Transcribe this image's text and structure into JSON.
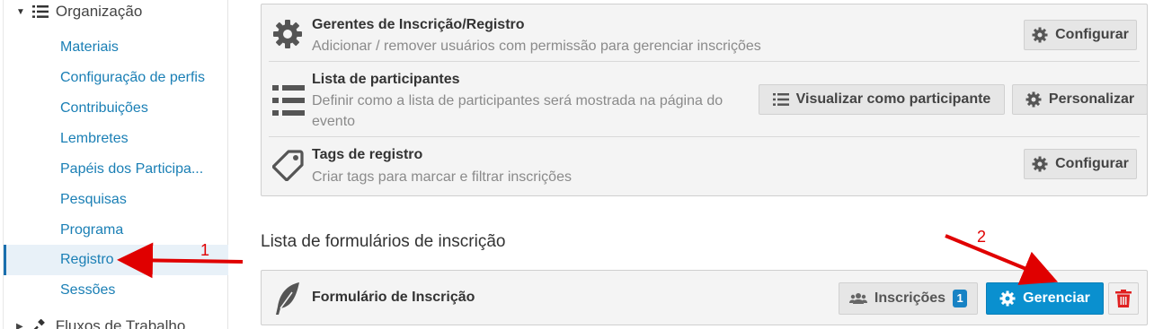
{
  "sidebar": {
    "section_label": "Organização",
    "items": [
      {
        "label": "Materiais"
      },
      {
        "label": "Configuração de perfis"
      },
      {
        "label": "Contribuições"
      },
      {
        "label": "Lembretes"
      },
      {
        "label": "Papéis dos Participa..."
      },
      {
        "label": "Pesquisas"
      },
      {
        "label": "Programa"
      },
      {
        "label": "Registro"
      },
      {
        "label": "Sessões"
      }
    ],
    "active_item": "Registro",
    "next_section_label": "Fluxos de Trabalho"
  },
  "settings": {
    "rows": [
      {
        "title": "Gerentes de Inscrição/Registro",
        "description": "Adicionar / remover usuários com permissão para gerenciar inscrições",
        "icon": "gear-icon",
        "button": "Configurar"
      },
      {
        "title": "Lista de participantes",
        "description_line1": "Definir como a lista de participantes será mostrada na página do",
        "description_line2": "evento",
        "icon": "list-icon",
        "button_view": "Visualizar como participante",
        "button_customize": "Personalizar"
      },
      {
        "title": "Tags de registro",
        "description": "Criar tags para marcar e filtrar inscrições",
        "icon": "tag-icon",
        "button": "Configurar"
      }
    ]
  },
  "forms": {
    "heading": "Lista de formulários de inscrição",
    "items": [
      {
        "title": "Formulário de Inscrição",
        "icon": "feather-icon",
        "registrations_label": "Inscrições",
        "registrations_count": "1",
        "manage_label": "Gerenciar",
        "delete_icon": "trash-icon"
      }
    ]
  },
  "annotations": {
    "marker_1": "1",
    "marker_2": "2",
    "color": "#e00000"
  },
  "colors": {
    "link": "#1a7fb5",
    "primary_button": "#0a90cf",
    "badge": "#1782c4",
    "delete": "#e02020"
  }
}
